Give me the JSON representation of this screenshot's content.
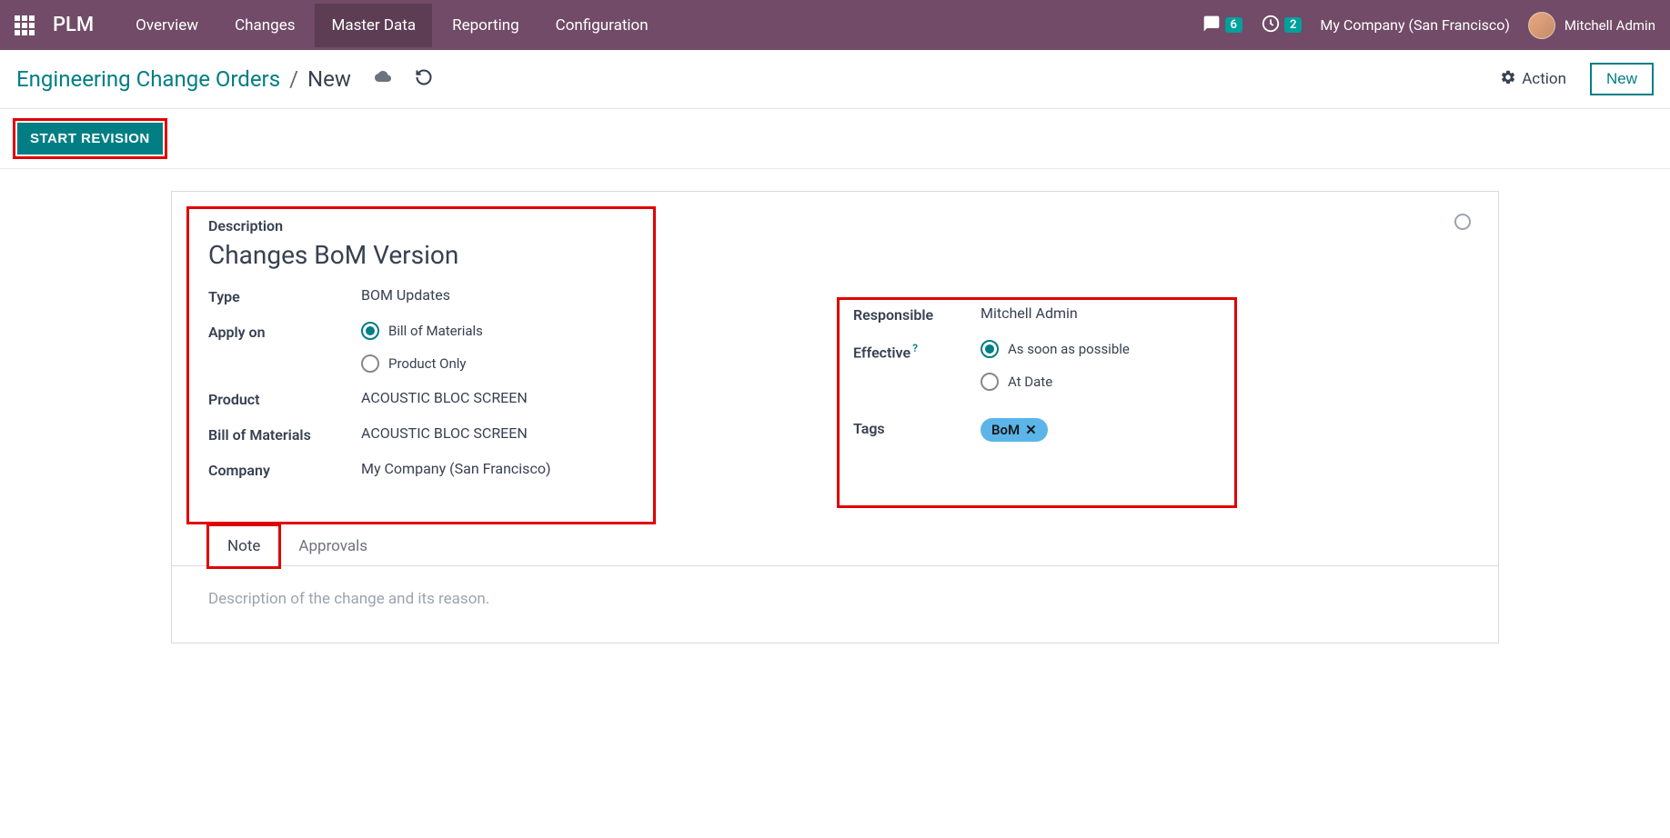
{
  "nav": {
    "brand": "PLM",
    "items": [
      "Overview",
      "Changes",
      "Master Data",
      "Reporting",
      "Configuration"
    ],
    "active_index": 2,
    "chat_badge": "6",
    "clock_badge": "2",
    "company": "My Company (San Francisco)",
    "user": "Mitchell Admin"
  },
  "breadcrumb": {
    "root": "Engineering Change Orders",
    "current": "New"
  },
  "controls": {
    "action_label": "Action",
    "new_label": "New"
  },
  "statusbar": {
    "start_revision": "START REVISION"
  },
  "form": {
    "description_label": "Description",
    "description_value": "Changes  BoM Version",
    "type_label": "Type",
    "type_value": "BOM Updates",
    "apply_on_label": "Apply on",
    "apply_on_options": {
      "bom": "Bill of Materials",
      "product": "Product Only"
    },
    "product_label": "Product",
    "product_value": "ACOUSTIC BLOC SCREEN",
    "bom_label": "Bill of Materials",
    "bom_value": "ACOUSTIC BLOC SCREEN",
    "company_label": "Company",
    "company_value": "My Company (San Francisco)",
    "responsible_label": "Responsible",
    "responsible_value": "Mitchell Admin",
    "effective_label": "Effective",
    "effective_options": {
      "asap": "As soon as possible",
      "atdate": "At Date"
    },
    "tags_label": "Tags",
    "tags": [
      "BoM"
    ]
  },
  "tabs": {
    "items": [
      "Note",
      "Approvals"
    ],
    "active_index": 0,
    "note_placeholder": "Description of the change and its reason."
  }
}
